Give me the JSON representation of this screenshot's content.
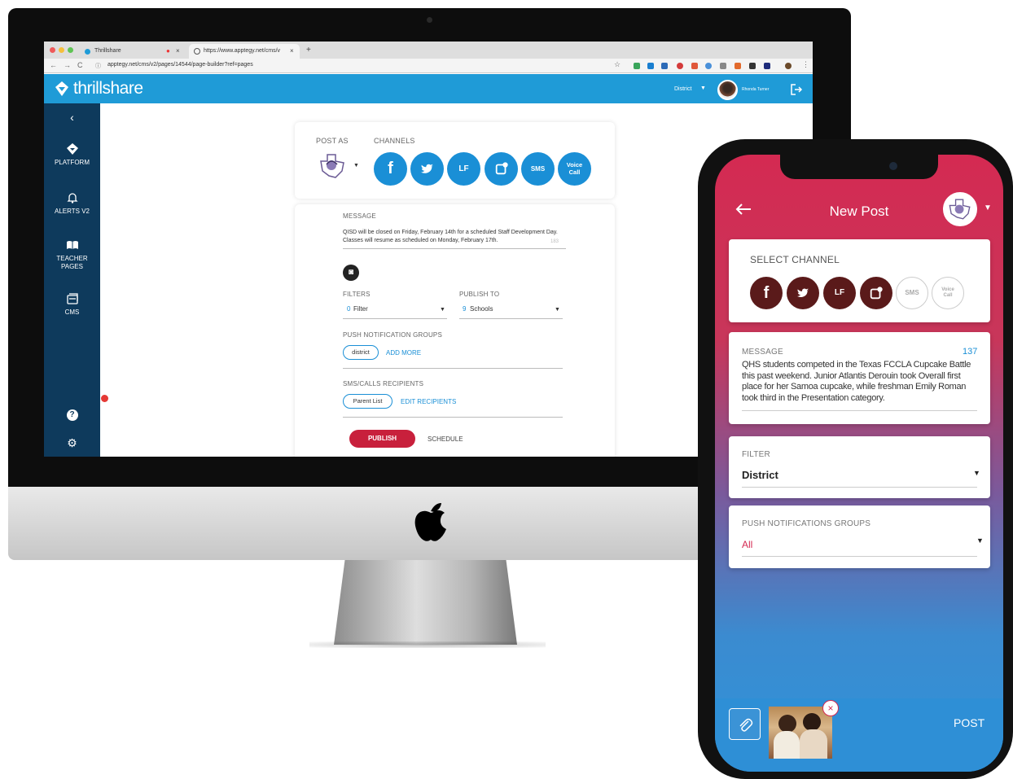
{
  "browser": {
    "tabs": [
      {
        "title": "Thrillshare"
      },
      {
        "title": "https://www.apptegy.net/cms/v"
      }
    ],
    "url": "apptegy.net/cms/v2/pages/14544/page-builder?ref=pages"
  },
  "app": {
    "brand": "thrillshare",
    "header": {
      "district_label": "District",
      "user_name": "Rhonda Turner"
    },
    "sidebar": [
      {
        "label": "PLATFORM",
        "icon": "thrillshare-logo-icon"
      },
      {
        "label": "ALERTS V2",
        "icon": "bell-icon"
      },
      {
        "label": "TEACHER PAGES",
        "icon": "book-icon"
      },
      {
        "label": "CMS",
        "icon": "cms-icon"
      }
    ],
    "post_as_label": "POST AS",
    "channels_label": "CHANNELS",
    "channels": [
      {
        "label": "f",
        "icon": "facebook-icon"
      },
      {
        "label": "",
        "icon": "twitter-icon"
      },
      {
        "label": "LF",
        "icon": "live-feed-icon"
      },
      {
        "label": "",
        "icon": "mobile-app-icon"
      },
      {
        "label": "SMS",
        "icon": "sms-icon"
      },
      {
        "label": "Voice Call",
        "icon": "voice-call-icon"
      }
    ],
    "message_label": "MESSAGE",
    "message_text": "QISD will be closed on Friday, February 14th for a scheduled Staff Development Day. Classes will resume as scheduled on Monday, February 17th.",
    "message_count": "183",
    "filters_label": "FILTERS",
    "filters_count": "0",
    "filters_value": "Filter",
    "publish_to_label": "PUBLISH TO",
    "publish_to_count": "9",
    "publish_to_value": "Schools",
    "push_groups_label": "PUSH NOTIFICATION GROUPS",
    "push_group_tag": "district",
    "add_more_label": "ADD MORE",
    "sms_recipients_label": "SMS/CALLS RECIPIENTS",
    "sms_recipient_tag": "Parent List",
    "edit_recipients_label": "EDIT RECIPIENTS",
    "publish_button": "PUBLISH",
    "schedule_button": "SCHEDULE"
  },
  "phone": {
    "title": "New Post",
    "select_channel_label": "SELECT CHANNEL",
    "channels": [
      {
        "label": "f",
        "icon": "facebook-icon"
      },
      {
        "label": "",
        "icon": "twitter-icon"
      },
      {
        "label": "LF",
        "icon": "live-feed-icon"
      },
      {
        "label": "",
        "icon": "mobile-app-icon"
      },
      {
        "label": "SMS",
        "icon": "sms-icon"
      },
      {
        "label": "Voice Call",
        "icon": "voice-call-icon"
      }
    ],
    "message_label": "MESSAGE",
    "message_count": "137",
    "message_text": "QHS students competed in the Texas FCCLA Cupcake Battle this past weekend. Junior Atlantis Derouin took Overall first place for her Samoa cupcake, while freshman Emily Roman took third in the Presentation category.",
    "filter_label": "FILTER",
    "filter_value": "District",
    "push_groups_label": "PUSH NOTIFICATIONS GROUPS",
    "push_groups_value": "All",
    "post_button": "POST"
  },
  "colors": {
    "thrillshare_blue": "#1f9bd7",
    "sidebar_navy": "#0e3a5c",
    "channel_blue": "#1a8fd6",
    "publish_red": "#c8203c",
    "phone_crimson": "#d42a52",
    "phone_channel_maroon": "#5a1a1a"
  }
}
